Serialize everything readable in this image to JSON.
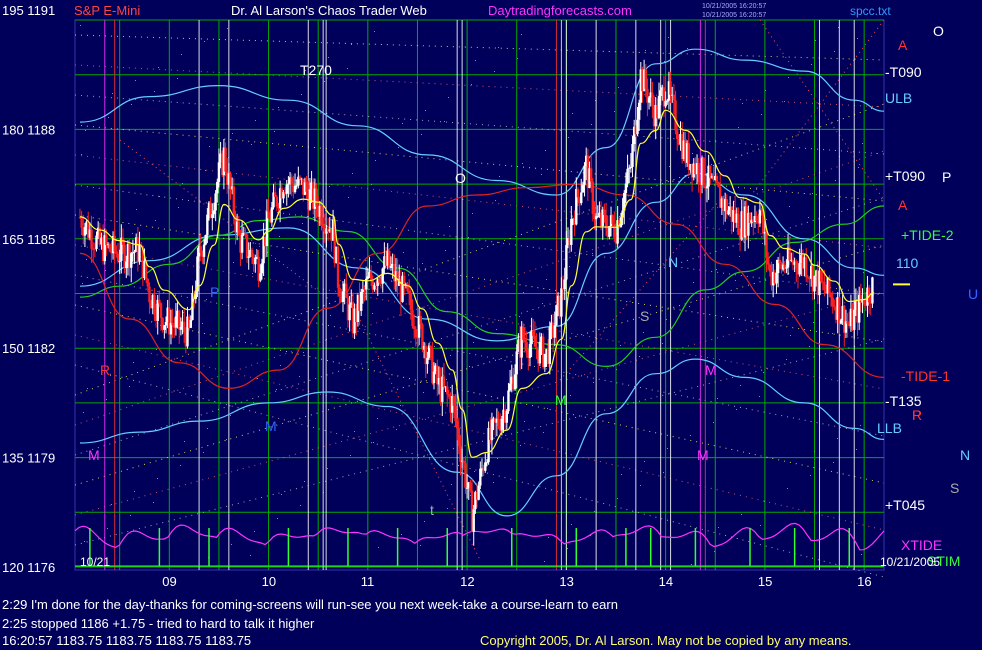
{
  "header": {
    "symbol": "S&P E-Mini",
    "title": "Dr. Al Larson's Chaos Trader Web",
    "site": "Daytradingforecasts.com",
    "stamp_line1": "10/21/2005 16:20:57",
    "stamp_line2": "10/21/2005 16:20:57",
    "filename": "spcc.txt",
    "top_left": "195  1191"
  },
  "footer": {
    "line1": "2:29 I'm done for the day-thanks for coming-screens will run-see you next week-take a course-learn to earn",
    "line2": "2:25 stopped 1186 +1.75 - tried to hard to talk it higher",
    "line3": "16:20:57  1183.75  1183.75  1183.75  1183.75",
    "copyright": "Copyright 2005, Dr. Al Larson. May not be copied by any means.",
    "date_left": "10/21",
    "date_right": "10/21/2005"
  },
  "right_labels": [
    {
      "text": "O",
      "color": "#ffffff"
    },
    {
      "text": "-T090",
      "color": "#ffffff"
    },
    {
      "text": "ULB",
      "color": "#66ccff"
    },
    {
      "text": "+T090",
      "color": "#ffffff"
    },
    {
      "text": "P",
      "color": "#ffffff"
    },
    {
      "text": "+TIDE-2",
      "color": "#33ff33"
    },
    {
      "text": "110",
      "color": "#66ccff"
    },
    {
      "text": "U",
      "color": "#3366ff"
    },
    {
      "text": "-TIDE-1",
      "color": "#ff3333"
    },
    {
      "text": "-T135",
      "color": "#ffffff"
    },
    {
      "text": "R",
      "color": "#ff3333"
    },
    {
      "text": "LLB",
      "color": "#66ccff"
    },
    {
      "text": "N",
      "color": "#66ccff"
    },
    {
      "text": "S",
      "color": "#aaaaaa"
    },
    {
      "text": "+T045",
      "color": "#ffffff"
    },
    {
      "text": "XTIDE",
      "color": "#ff33ff"
    },
    {
      "text": "STIM",
      "color": "#33ff33"
    }
  ],
  "inline_labels": [
    {
      "text": "T270",
      "color": "#ffffff"
    },
    {
      "text": "O",
      "color": "#ffffff"
    },
    {
      "text": "N",
      "color": "#66ccff"
    },
    {
      "text": "S",
      "color": "#aaaaaa"
    },
    {
      "text": "R",
      "color": "#ff3333"
    },
    {
      "text": "M",
      "color": "#ff33ff"
    },
    {
      "text": "M",
      "color": "#3366ff"
    },
    {
      "text": "M",
      "color": "#ff33ff"
    },
    {
      "text": "M",
      "color": "#ff33ff"
    },
    {
      "text": "t",
      "color": "#aaaaaa"
    },
    {
      "text": "A",
      "color": "#ff3333"
    },
    {
      "text": "A",
      "color": "#ff3333"
    },
    {
      "text": "P",
      "color": "#3366ff"
    },
    {
      "text": "P",
      "color": "#ff3333"
    },
    {
      "text": "M",
      "color": "#33ff33"
    }
  ],
  "colors": {
    "background": "#00005a",
    "grid": "#00aa00",
    "price_up": "#ffffff",
    "price_down": "#ff2020",
    "ema_yellow": "#ffff33",
    "band_cyan": "#66ccff",
    "tide_red": "#dd2222",
    "tide_green": "#22cc22",
    "xtide": "#ff33ff",
    "stim": "#33ff33",
    "header_red": "#ff4444",
    "header_white": "#ffffff",
    "header_magenta": "#ff33ff",
    "header_blue": "#3399ff"
  },
  "chart_data": {
    "type": "candlestick",
    "title": "S&P E-Mini",
    "x_axis": {
      "ticks": [
        "09",
        "10",
        "11",
        "12",
        "13",
        "14",
        "15",
        "16"
      ],
      "unit": "hour"
    },
    "y_axis": {
      "ticks_price": [
        1176,
        1179,
        1182,
        1185,
        1188,
        1191
      ],
      "ticks_angle": [
        120,
        135,
        150,
        165,
        180,
        195
      ],
      "ylim": [
        1176,
        1191
      ]
    },
    "close_series": [
      {
        "time": 8.1,
        "price": 1185.6
      },
      {
        "time": 8.3,
        "price": 1184.8
      },
      {
        "time": 8.5,
        "price": 1184.6
      },
      {
        "time": 8.7,
        "price": 1184.7
      },
      {
        "time": 8.8,
        "price": 1183.5
      },
      {
        "time": 8.95,
        "price": 1182.8
      },
      {
        "time": 9.2,
        "price": 1182.4
      },
      {
        "time": 9.3,
        "price": 1184.5
      },
      {
        "time": 9.45,
        "price": 1186.2
      },
      {
        "time": 9.55,
        "price": 1187.3
      },
      {
        "time": 9.7,
        "price": 1185.0
      },
      {
        "time": 9.9,
        "price": 1184.3
      },
      {
        "time": 10.0,
        "price": 1185.5
      },
      {
        "time": 10.15,
        "price": 1186.6
      },
      {
        "time": 10.35,
        "price": 1186.4
      },
      {
        "time": 10.5,
        "price": 1185.9
      },
      {
        "time": 10.65,
        "price": 1185.2
      },
      {
        "time": 10.7,
        "price": 1183.9
      },
      {
        "time": 10.85,
        "price": 1182.7
      },
      {
        "time": 11.0,
        "price": 1183.8
      },
      {
        "time": 11.2,
        "price": 1184.3
      },
      {
        "time": 11.4,
        "price": 1183.3
      },
      {
        "time": 11.55,
        "price": 1182.3
      },
      {
        "time": 11.7,
        "price": 1181.0
      },
      {
        "time": 11.85,
        "price": 1180.5
      },
      {
        "time": 11.95,
        "price": 1179.0
      },
      {
        "time": 12.05,
        "price": 1177.4
      },
      {
        "time": 12.2,
        "price": 1179.3
      },
      {
        "time": 12.4,
        "price": 1180.5
      },
      {
        "time": 12.55,
        "price": 1182.3
      },
      {
        "time": 12.8,
        "price": 1181.8
      },
      {
        "time": 12.95,
        "price": 1183.4
      },
      {
        "time": 13.05,
        "price": 1185.5
      },
      {
        "time": 13.2,
        "price": 1187.0
      },
      {
        "time": 13.3,
        "price": 1185.5
      },
      {
        "time": 13.5,
        "price": 1185.3
      },
      {
        "time": 13.65,
        "price": 1187.0
      },
      {
        "time": 13.75,
        "price": 1189.5
      },
      {
        "time": 13.9,
        "price": 1188.4
      },
      {
        "time": 14.0,
        "price": 1189.2
      },
      {
        "time": 14.2,
        "price": 1187.3
      },
      {
        "time": 14.4,
        "price": 1186.7
      },
      {
        "time": 14.6,
        "price": 1185.9
      },
      {
        "time": 14.75,
        "price": 1185.4
      },
      {
        "time": 14.95,
        "price": 1185.8
      },
      {
        "time": 15.05,
        "price": 1184.0
      },
      {
        "time": 15.2,
        "price": 1184.3
      },
      {
        "time": 15.4,
        "price": 1184.4
      },
      {
        "time": 15.5,
        "price": 1183.9
      },
      {
        "time": 15.7,
        "price": 1183.3
      },
      {
        "time": 15.85,
        "price": 1182.6
      },
      {
        "time": 16.0,
        "price": 1183.4
      },
      {
        "time": 16.1,
        "price": 1183.75
      }
    ],
    "last_price": 1183.75
  }
}
